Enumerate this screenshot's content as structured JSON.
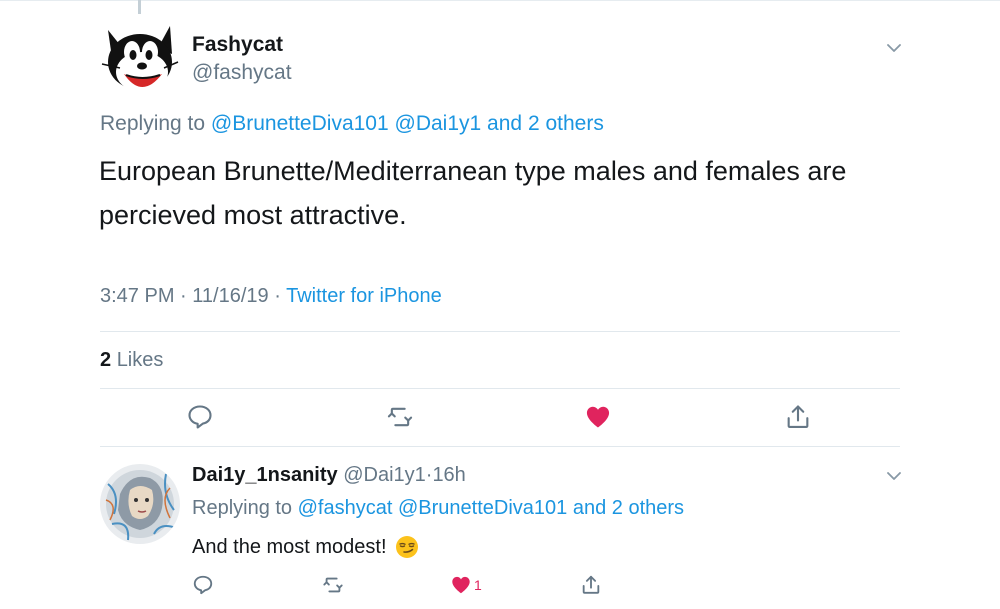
{
  "colors": {
    "link": "#1b95e0",
    "muted": "#657786",
    "like": "#e0245e"
  },
  "main_tweet": {
    "display_name": "Fashycat",
    "handle": "@fashycat",
    "replying_prefix": "Replying to",
    "replying_to_1": "@BrunetteDiva101",
    "replying_to_2": "@Dai1y1",
    "replying_and": "and",
    "replying_others": "2 others",
    "text": "European Brunette/Mediterranean type males and females are percieved most attractive.",
    "time": "3:47 PM",
    "sep1": "·",
    "date": "11/16/19",
    "sep2": "·",
    "source": "Twitter for iPhone",
    "likes_count": "2",
    "likes_label": "Likes",
    "icons": [
      "reply-icon",
      "retweet-icon",
      "like-icon-filled",
      "share-icon"
    ]
  },
  "reply_tweet": {
    "display_name": "Dai1y_1nsanity",
    "handle": "@Dai1y1",
    "sep": "·",
    "age": "16h",
    "replying_prefix": "Replying to",
    "replying_to_1": "@fashycat",
    "replying_to_2": "@BrunetteDiva101",
    "replying_and": "and",
    "replying_others": "2 others",
    "text": "And the most modest!",
    "emoji": "smirk-emoji",
    "like_count": "1",
    "icons": [
      "reply-icon",
      "retweet-icon",
      "like-icon-filled",
      "share-icon"
    ]
  }
}
